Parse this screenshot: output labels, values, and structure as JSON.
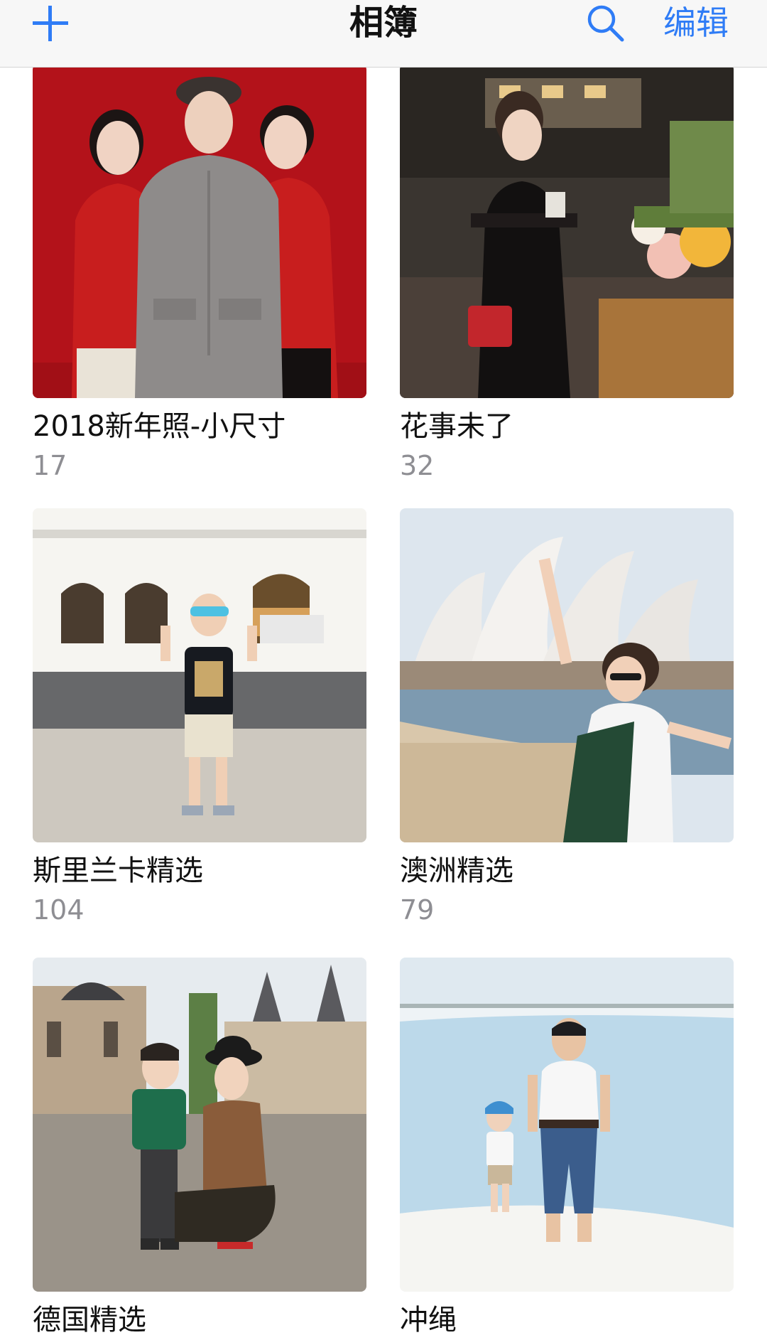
{
  "navbar": {
    "title": "相簿",
    "edit_label": "编辑",
    "add_icon": "plus-icon",
    "search_icon": "search-icon",
    "accent_color": "#2f7cf6"
  },
  "albums": [
    {
      "name": "2018新年照-小尺寸",
      "count": "17"
    },
    {
      "name": "花事未了",
      "count": "32"
    },
    {
      "name": "斯里兰卡精选",
      "count": "104"
    },
    {
      "name": "澳洲精选",
      "count": "79"
    },
    {
      "name": "德国精选",
      "count": ""
    },
    {
      "name": "冲绳",
      "count": ""
    }
  ]
}
